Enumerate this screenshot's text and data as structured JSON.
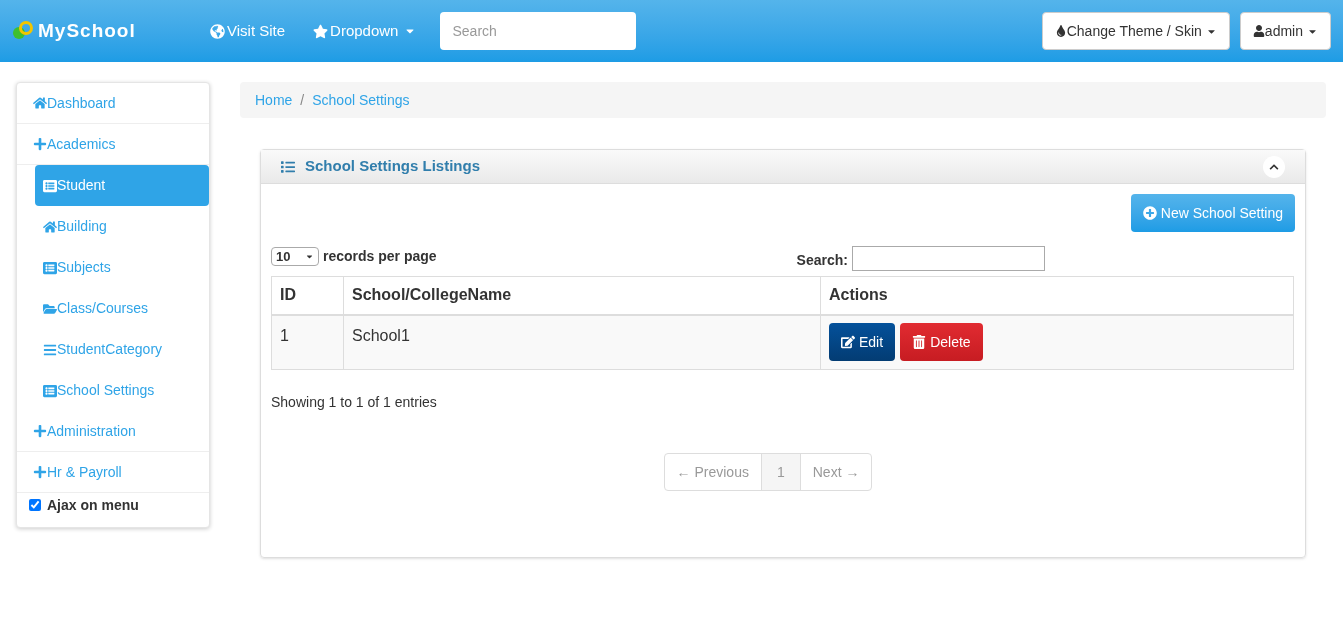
{
  "navbar": {
    "brand": "MySchool",
    "links": [
      {
        "label": "Visit Site",
        "kind": "link"
      },
      {
        "label": "Dropdown",
        "kind": "dropdown"
      }
    ],
    "search": {
      "placeholder": "Search"
    },
    "right_buttons": [
      {
        "label": "Change Theme / Skin"
      },
      {
        "label": "admin"
      }
    ]
  },
  "sidebar": {
    "items": [
      {
        "label": "Dashboard",
        "kind": "section",
        "selected": false
      },
      {
        "label": "Academics",
        "kind": "section",
        "selected": false
      },
      {
        "label": "Student",
        "kind": "subitem",
        "selected": true
      },
      {
        "label": "Building",
        "kind": "subitem",
        "selected": false
      },
      {
        "label": "Subjects",
        "kind": "subitem",
        "selected": false
      },
      {
        "label": "Class/Courses",
        "kind": "subitem",
        "selected": false
      },
      {
        "label": "StudentCategory",
        "kind": "subitem",
        "selected": false
      },
      {
        "label": "School Settings",
        "kind": "subitem",
        "selected": false
      },
      {
        "label": "Administration",
        "kind": "section",
        "selected": false
      },
      {
        "label": "Hr & Payroll",
        "kind": "section",
        "selected": false
      }
    ],
    "ajax_option": {
      "label": "Ajax on menu",
      "checked": true
    }
  },
  "breadcrumb": {
    "items": [
      "Home",
      "School Settings"
    ],
    "separator": "/"
  },
  "panel": {
    "title": "School Settings Listings",
    "new_button": "New School Setting",
    "page_size": "10",
    "page_size_label": "records per page",
    "search_label": "Search:",
    "table": {
      "columns": [
        "ID",
        "School/CollegeName",
        "Actions"
      ],
      "rows": [
        {
          "id": "1",
          "name": "School1",
          "actions": [
            "Edit",
            "Delete"
          ]
        }
      ]
    },
    "info": "Showing 1 to 1 of 1 entries",
    "pagination": {
      "previous": {
        "label": "← Previous",
        "disabled": true
      },
      "pages": [
        {
          "label": "1",
          "selected": true
        }
      ],
      "next": {
        "label": "Next →",
        "disabled": true
      }
    }
  }
}
